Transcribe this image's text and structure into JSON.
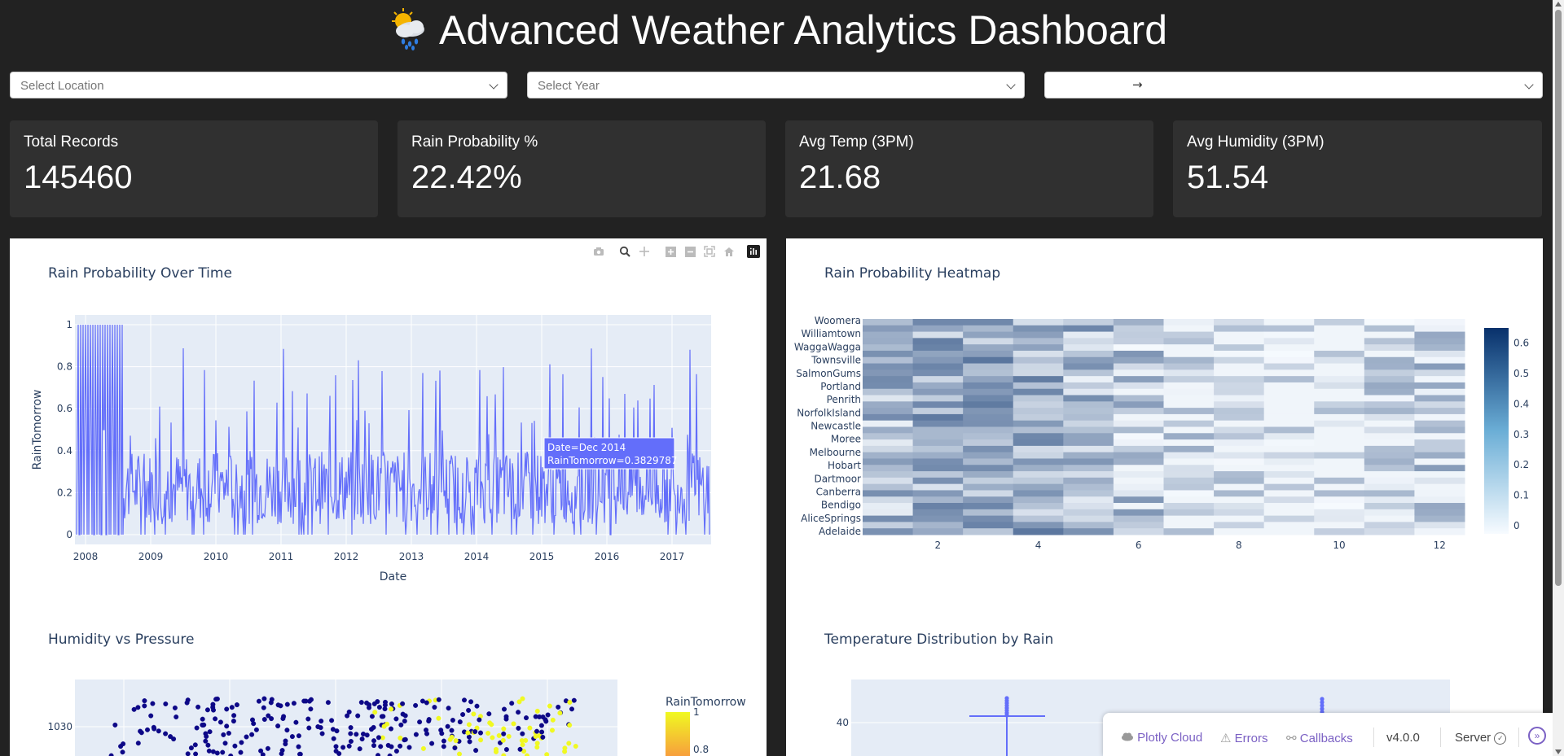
{
  "header": {
    "title": "Advanced Weather Analytics Dashboard",
    "icon": "cloud-rain-sun-icon"
  },
  "filters": {
    "location_placeholder": "Select Location",
    "year_placeholder": "Select Year",
    "date_range_arrow": "→"
  },
  "kpis": [
    {
      "label": "Total Records",
      "value": "145460"
    },
    {
      "label": "Rain Probability %",
      "value": "22.42%"
    },
    {
      "label": "Avg Temp (3PM)",
      "value": "21.68"
    },
    {
      "label": "Avg Humidity (3PM)",
      "value": "51.54"
    }
  ],
  "colors": {
    "background": "#222222",
    "card": "#303030",
    "line": "#636efa",
    "plot_bg": "#e5ecf6"
  },
  "charts": {
    "line_title": "Rain Probability Over Time",
    "heatmap_title": "Rain Probability Heatmap",
    "scatter_title": "Humidity vs Pressure",
    "box_title": "Temperature Distribution by Rain"
  },
  "chart_data": [
    {
      "type": "line",
      "title": "Rain Probability Over Time",
      "xlabel": "Date",
      "ylabel": "RainTomorrow",
      "x_ticks": [
        "2008",
        "2009",
        "2010",
        "2011",
        "2012",
        "2013",
        "2014",
        "2015",
        "2016",
        "2017"
      ],
      "y_ticks": [
        "0",
        "0.2",
        "0.4",
        "0.6",
        "0.8",
        "1"
      ],
      "ylim": [
        0,
        1
      ],
      "xlim": [
        "2007-11",
        "2017-06"
      ],
      "hover": {
        "date": "Date=Dec 2014",
        "value": "RainTomorrow=0.3829787"
      },
      "color": "#636efa"
    },
    {
      "type": "heatmap",
      "title": "Rain Probability Heatmap",
      "y_labels": [
        "Adelaide",
        "AliceSprings",
        "Bendigo",
        "Canberra",
        "Dartmoor",
        "Hobart",
        "Melbourne",
        "Moree",
        "Newcastle",
        "NorfolkIsland",
        "Penrith",
        "Portland",
        "SalmonGums",
        "Townsville",
        "WaggaWagga",
        "Williamtown",
        "Woomera"
      ],
      "x_ticks": [
        "2",
        "4",
        "6",
        "8",
        "10",
        "12"
      ],
      "colorbar_ticks": [
        "0",
        "0.1",
        "0.2",
        "0.3",
        "0.4",
        "0.5",
        "0.6"
      ],
      "zlim": [
        0,
        0.65
      ]
    },
    {
      "type": "scatter",
      "title": "Humidity vs Pressure",
      "y_ticks": [
        "1030"
      ],
      "colorbar_title": "RainTomorrow",
      "colorbar_ticks": [
        "1",
        "0.8"
      ]
    },
    {
      "type": "box",
      "title": "Temperature Distribution by Rain",
      "y_ticks": [
        "40"
      ]
    }
  ],
  "modebar": [
    "camera-icon",
    "zoom-icon",
    "pan-icon",
    "zoom-in-icon",
    "zoom-out-icon",
    "autoscale-icon",
    "reset-icon",
    "plotly-logo-icon"
  ],
  "devtools": {
    "plotly_cloud": "Plotly Cloud",
    "errors": "Errors",
    "callbacks": "Callbacks",
    "version": "v4.0.0",
    "server": "Server"
  }
}
